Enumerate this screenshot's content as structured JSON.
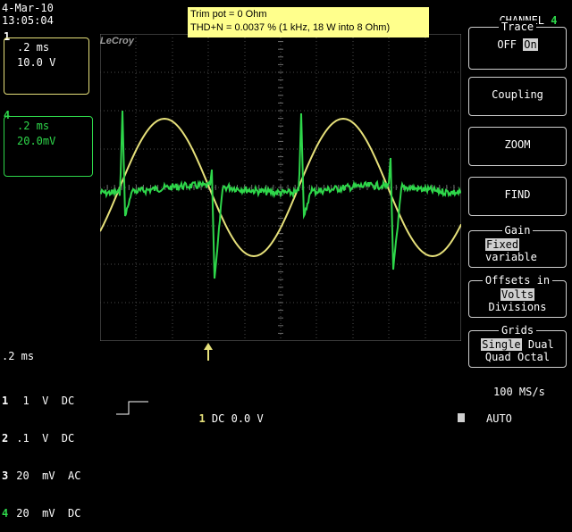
{
  "header": {
    "date": "4-Mar-10",
    "time": "13:05:04"
  },
  "annotation": {
    "line1": "Trim pot = 0 Ohm",
    "line2": "THD+N = 0.0037 % (1 kHz, 18 W into 8 Ohm)"
  },
  "brand": "LeCroy",
  "channel_boxes": [
    {
      "id": "1",
      "timebase": ".2 ms",
      "volts": "10.0 V",
      "color": "#e6e07a"
    },
    {
      "id": "4",
      "timebase": ".2 ms",
      "volts": "20.0mV",
      "color": "#2ed64a"
    }
  ],
  "timebase_readout": ".2 ms",
  "channel_settings": [
    {
      "num": "1",
      "text": "  1  V  DC"
    },
    {
      "num": "2",
      "text": " .1  V  DC"
    },
    {
      "num": "3",
      "text": " 20  mV  AC"
    },
    {
      "num": "4",
      "text": " 20  mV  DC"
    }
  ],
  "trigger": {
    "num": "1",
    "text": "DC 0.0 V"
  },
  "right_panel": {
    "title": "CHANNEL",
    "channel": "4",
    "trace": {
      "caption": "Trace",
      "off": "OFF",
      "on": "On"
    },
    "coupling": "Coupling",
    "zoom": "ZOOM",
    "find": "FIND",
    "gain": {
      "caption": "Gain",
      "fixed": "Fixed",
      "variable": "variable"
    },
    "offsets": {
      "caption": "Offsets in",
      "volts": "Volts",
      "divisions": "Divisions"
    },
    "grids": {
      "caption": "Grids",
      "single": "Single",
      "dual": "Dual",
      "quad": "Quad",
      "octal": "Octal"
    },
    "sample_rate": "100 MS/s",
    "mode": "AUTO"
  },
  "colors": {
    "ch1": "#e6e07a",
    "ch4": "#2ed64a",
    "grid": "#6e6e6e"
  },
  "icons": [
    "trigger-arrow-icon",
    "ground-marker-icon",
    "trigger-edge-icon"
  ]
}
